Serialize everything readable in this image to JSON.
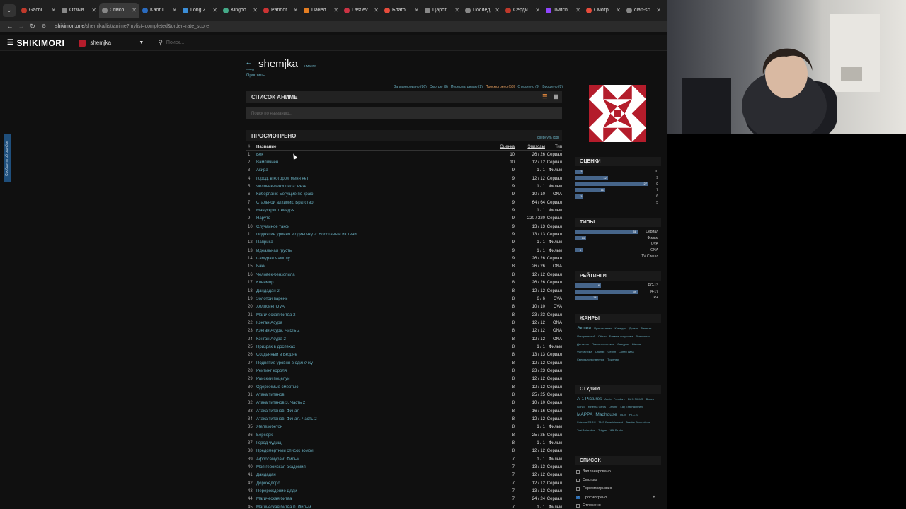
{
  "browser": {
    "tabs": [
      {
        "title": "Gachi",
        "color": "#c0392b"
      },
      {
        "title": "Отзыв",
        "color": "#888"
      },
      {
        "title": "Списо",
        "color": "#888",
        "active": true
      },
      {
        "title": "Kaoru",
        "color": "#2a6bbf"
      },
      {
        "title": "Long Z",
        "color": "#3b8ed8"
      },
      {
        "title": "Kingdo",
        "color": "#4a8"
      },
      {
        "title": "Pandor",
        "color": "#c33"
      },
      {
        "title": "Панел",
        "color": "#e67e22"
      },
      {
        "title": "Last ev",
        "color": "#c34"
      },
      {
        "title": "Благо",
        "color": "#e74c3c"
      },
      {
        "title": "Царст",
        "color": "#888"
      },
      {
        "title": "Послед",
        "color": "#888"
      },
      {
        "title": "Серди",
        "color": "#c0392b"
      },
      {
        "title": "Twitch",
        "color": "#9146ff"
      },
      {
        "title": "Смотр",
        "color": "#e74c3c"
      },
      {
        "title": "clan-sc",
        "color": "#888"
      }
    ],
    "url_host": "shikimori.one",
    "url_path": "/shemjka/list/anime?mylist=completed&order=rate_score"
  },
  "header": {
    "logo": "SHIKIMORI",
    "username": "shemjka",
    "search_placeholder": "Поиск..."
  },
  "report_tab": "Сообщить об ошибке",
  "profile": {
    "back_label": "назад",
    "name": "shemjka",
    "in_manga": "к манге",
    "profile_link": "Профиль"
  },
  "status_links": [
    {
      "label": "Запланировано (86)"
    },
    {
      "label": "Смотрю (9)"
    },
    {
      "label": "Пересматриваю (2)"
    },
    {
      "label": "Просмотрено (58)",
      "current": true
    },
    {
      "label": "Отложено (9)"
    },
    {
      "label": "Брошено (8)"
    }
  ],
  "list": {
    "title": "СПИСОК АНИМЕ",
    "filter_placeholder": "Поиск по названию...",
    "section_title": "ПРОСМОТРЕНО",
    "collapse_label": "свернуть (58)",
    "columns": [
      "#",
      "Название",
      "Оценка",
      "Эпизоды",
      "Тип"
    ],
    "rows": [
      [
        "1",
        "Бек",
        "10",
        "26 / 26",
        "Сериал"
      ],
      [
        "2",
        "Вампичиен",
        "10",
        "12 / 12",
        "Сериал"
      ],
      [
        "3",
        "Акира",
        "9",
        "1 / 1",
        "Фильм"
      ],
      [
        "4",
        "Город, в котором меня нет",
        "9",
        "12 / 12",
        "Сериал"
      ],
      [
        "5",
        "Человек-бензопила: Резе",
        "9",
        "1 / 1",
        "Фильм"
      ],
      [
        "6",
        "Киберпанк: Бегущие по краю",
        "9",
        "10 / 10",
        "ONA"
      ],
      [
        "7",
        "Стальной алхимик: Братство",
        "9",
        "64 / 64",
        "Сериал"
      ],
      [
        "8",
        "Манускрипт ниндзя",
        "9",
        "1 / 1",
        "Фильм"
      ],
      [
        "9",
        "Наруто",
        "9",
        "220 / 220",
        "Сериал"
      ],
      [
        "10",
        "Случайное такси",
        "9",
        "13 / 13",
        "Сериал"
      ],
      [
        "11",
        "Поднятие уровня в одиночку 2: Восстаньте из тени",
        "9",
        "13 / 13",
        "Сериал"
      ],
      [
        "12",
        "Паприка",
        "9",
        "1 / 1",
        "Фильм"
      ],
      [
        "13",
        "Идеальная грусть",
        "9",
        "1 / 1",
        "Фильм"
      ],
      [
        "14",
        "Самурай Чамплу",
        "9",
        "26 / 26",
        "Сериал"
      ],
      [
        "15",
        "Баки",
        "8",
        "26 / 26",
        "ONA"
      ],
      [
        "16",
        "Человек-бензопила",
        "8",
        "12 / 12",
        "Сериал"
      ],
      [
        "17",
        "Клеймор",
        "8",
        "26 / 26",
        "Сериал"
      ],
      [
        "18",
        "Дандадан 2",
        "8",
        "12 / 12",
        "Сериал"
      ],
      [
        "19",
        "Золотой парень",
        "8",
        "6 / 6",
        "OVA"
      ],
      [
        "20",
        "Хеллсинг OVA",
        "8",
        "10 / 10",
        "OVA"
      ],
      [
        "21",
        "Магическая битва 2",
        "8",
        "23 / 23",
        "Сериал"
      ],
      [
        "22",
        "Кэнган Асура",
        "8",
        "12 / 12",
        "ONA"
      ],
      [
        "23",
        "Кэнган Асура. Часть 2",
        "8",
        "12 / 12",
        "ONA"
      ],
      [
        "24",
        "Кэнган Асура 2",
        "8",
        "12 / 12",
        "ONA"
      ],
      [
        "25",
        "Призрак в доспехах",
        "8",
        "1 / 1",
        "Фильм"
      ],
      [
        "26",
        "Созданный в Бездне",
        "8",
        "13 / 13",
        "Сериал"
      ],
      [
        "27",
        "Поднятие уровня в одиночку",
        "8",
        "12 / 12",
        "Сериал"
      ],
      [
        "28",
        "Рейтинг короля",
        "8",
        "23 / 23",
        "Сериал"
      ],
      [
        "29",
        "Райский поцелуй",
        "8",
        "12 / 12",
        "Сериал"
      ],
      [
        "30",
        "Одержимые смертью",
        "8",
        "12 / 12",
        "Сериал"
      ],
      [
        "31",
        "Атака титанов",
        "8",
        "25 / 25",
        "Сериал"
      ],
      [
        "32",
        "Атака титанов 3. Часть 2",
        "8",
        "10 / 10",
        "Сериал"
      ],
      [
        "33",
        "Атака титанов: Финал",
        "8",
        "16 / 16",
        "Сериал"
      ],
      [
        "34",
        "Атака титанов: Финал. Часть 2",
        "8",
        "12 / 12",
        "Сериал"
      ],
      [
        "35",
        "Железобетон",
        "8",
        "1 / 1",
        "Фильм"
      ],
      [
        "36",
        "Берсерк",
        "8",
        "25 / 25",
        "Сериал"
      ],
      [
        "37",
        "Город чудищ",
        "8",
        "1 / 1",
        "Фильм"
      ],
      [
        "38",
        "Предсмертный список зомби",
        "8",
        "12 / 12",
        "Сериал"
      ],
      [
        "39",
        "Афросамурай: Фильм",
        "7",
        "1 / 1",
        "Фильм"
      ],
      [
        "40",
        "Моя геройская академия",
        "7",
        "13 / 13",
        "Сериал"
      ],
      [
        "41",
        "Дандадан",
        "7",
        "12 / 12",
        "Сериал"
      ],
      [
        "42",
        "Дорохедоро",
        "7",
        "12 / 12",
        "Сериал"
      ],
      [
        "43",
        "Перерождение Дяди",
        "7",
        "13 / 13",
        "Сериал"
      ],
      [
        "44",
        "Магическая битва",
        "7",
        "24 / 24",
        "Сериал"
      ],
      [
        "45",
        "Магическая битва 0. Фильм",
        "7",
        "1 / 1",
        "Фильм"
      ]
    ]
  },
  "sidebar": {
    "scores_title": "ОЦЕНКИ",
    "scores": [
      {
        "label": "10",
        "count": "3",
        "value": 3
      },
      {
        "label": "9",
        "count": "12",
        "value": 12
      },
      {
        "label": "8",
        "count": "27",
        "value": 27
      },
      {
        "label": "7",
        "count": "11",
        "value": 11
      },
      {
        "label": "6",
        "count": "3",
        "value": 3
      },
      {
        "label": "5",
        "count": "",
        "value": 0
      }
    ],
    "types_title": "ТИПЫ",
    "types": [
      {
        "label": "Сериал",
        "count": "58",
        "value": 58
      },
      {
        "label": "Фильм",
        "count": "10",
        "value": 10
      },
      {
        "label": "OVA",
        "count": "",
        "value": 0
      },
      {
        "label": "ONA",
        "count": "5",
        "value": 5
      },
      {
        "label": "TV Спешл",
        "count": "",
        "value": 0
      }
    ],
    "ratings_title": "РЕЙТИНГИ",
    "ratings": [
      {
        "label": "PG-13",
        "count": "16",
        "value": 16
      },
      {
        "label": "R-17",
        "count": "39",
        "value": 39
      },
      {
        "label": "R+",
        "count": "14",
        "value": 14
      }
    ],
    "genres_title": "ЖАНРЫ",
    "genres": [
      "Экшен",
      "Приключения",
      "Комедия",
      "Драма",
      "Фэнтези",
      "Исторический",
      "Сёнэн",
      "Боевые искусства",
      "Вселенная",
      "Детектив",
      "Психологическое",
      "Самураи",
      "Школа",
      "Фантастика",
      "Сэйнэн",
      "Сёнэн",
      "Супер сила",
      "Сверхъестественное",
      "Триллер"
    ],
    "studios_title": "СТУДИИ",
    "studios": [
      "A-1 Pictures",
      "Atelier Pontdarc",
      "BUG FILMS",
      "Bones",
      "Gonzo",
      "Kinema Citrus",
      "Lerche",
      "Lay Entertainment",
      "MAPPA",
      "Madhouse",
      "OLM",
      "P.I.C.S.",
      "Science SARU",
      "TMS Entertainment",
      "Tezuka Productions",
      "Toei Animation",
      "Trigger",
      "Wit Studio"
    ],
    "list_title": "СПИСОК",
    "list_filters": [
      {
        "label": "Запланировано",
        "checked": false
      },
      {
        "label": "Смотрю",
        "checked": false
      },
      {
        "label": "Пересматриваю",
        "checked": false
      },
      {
        "label": "Просмотрено",
        "checked": true
      },
      {
        "label": "Отложено",
        "checked": false
      }
    ]
  }
}
